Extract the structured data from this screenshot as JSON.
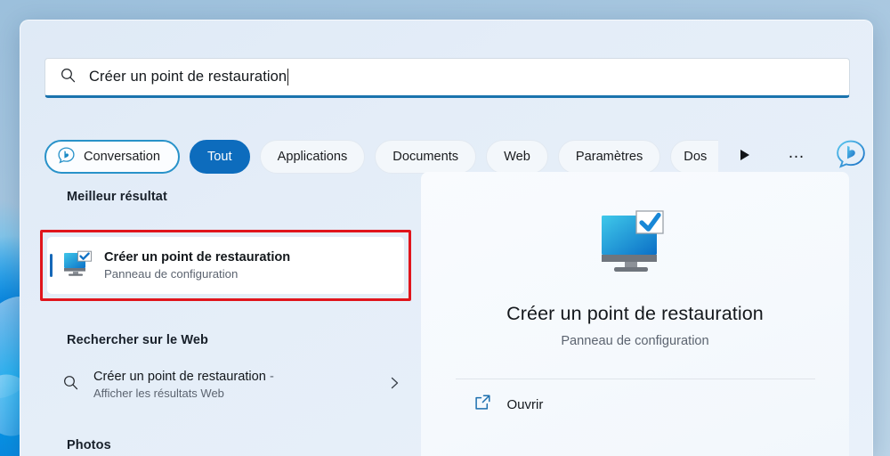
{
  "search": {
    "query": "Créer un point de restauration",
    "icon": "search-icon"
  },
  "filters": {
    "conversation": {
      "label": "Conversation",
      "icon": "bing-chat-icon"
    },
    "items": [
      {
        "label": "Tout",
        "active": true
      },
      {
        "label": "Applications",
        "active": false
      },
      {
        "label": "Documents",
        "active": false
      },
      {
        "label": "Web",
        "active": false
      },
      {
        "label": "Paramètres",
        "active": false
      },
      {
        "label": "Dos",
        "active": false,
        "clipped": true
      }
    ],
    "scroll_next_icon": "play-arrow-icon",
    "overflow_label": "…",
    "bing_logo_icon": "bing-logo-icon"
  },
  "results": {
    "best_match_heading": "Meilleur résultat",
    "best_match": {
      "title": "Créer un point de restauration",
      "subtitle": "Panneau de configuration",
      "icon": "restore-point-monitor-icon"
    },
    "web_heading": "Rechercher sur le Web",
    "web_result": {
      "title": "Créer un point de restauration",
      "title_suffix": "-",
      "subtitle": "Afficher les résultats Web",
      "icon": "search-icon",
      "chevron": "chevron-right-icon"
    },
    "photos_heading": "Photos"
  },
  "preview": {
    "icon": "restore-point-monitor-icon",
    "title": "Créer un point de restauration",
    "subtitle": "Panneau de configuration",
    "open_label": "Ouvrir",
    "open_icon": "external-link-icon"
  },
  "colors": {
    "accent": "#0d6cbd",
    "highlight_red": "#e0151c",
    "selection_bar": "#1668b8",
    "panel_bg": "#e4edf8"
  }
}
